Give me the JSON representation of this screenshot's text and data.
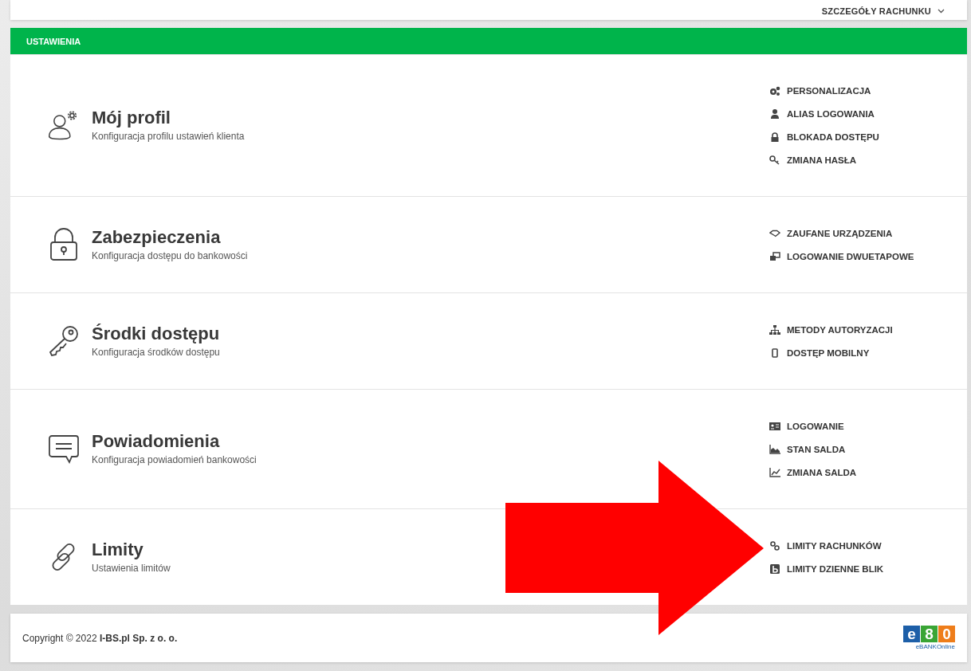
{
  "top_bar": {
    "account_menu": "SZCZEGÓŁY RACHUNKU"
  },
  "panel": {
    "title": "USTAWIENIA",
    "sections": [
      {
        "title": "Mój profil",
        "subtitle": "Konfiguracja profilu ustawień klienta",
        "links": [
          "PERSONALIZACJA",
          "ALIAS LOGOWANIA",
          "BLOKADA DOSTĘPU",
          "ZMIANA HASŁA"
        ]
      },
      {
        "title": "Zabezpieczenia",
        "subtitle": "Konfiguracja dostępu do bankowości",
        "links": [
          "ZAUFANE URZĄDZENIA",
          "LOGOWANIE DWUETAPOWE"
        ]
      },
      {
        "title": "Środki dostępu",
        "subtitle": "Konfiguracja środków dostępu",
        "links": [
          "METODY AUTORYZACJI",
          "DOSTĘP MOBILNY"
        ]
      },
      {
        "title": "Powiadomienia",
        "subtitle": "Konfiguracja powiadomień bankowości",
        "links": [
          "LOGOWANIE",
          "STAN SALDA",
          "ZMIANA SALDA"
        ]
      },
      {
        "title": "Limity",
        "subtitle": "Ustawienia limitów",
        "links": [
          "LIMITY RACHUNKÓW",
          "LIMITY DZIENNE BLIK"
        ]
      }
    ]
  },
  "footer": {
    "copyright": "Copyright © 2022 **I-BS.pl Sp. z o. o.**",
    "logo_letters": [
      "e",
      "8",
      "0"
    ],
    "logo_caption": "eBANKOnline"
  }
}
